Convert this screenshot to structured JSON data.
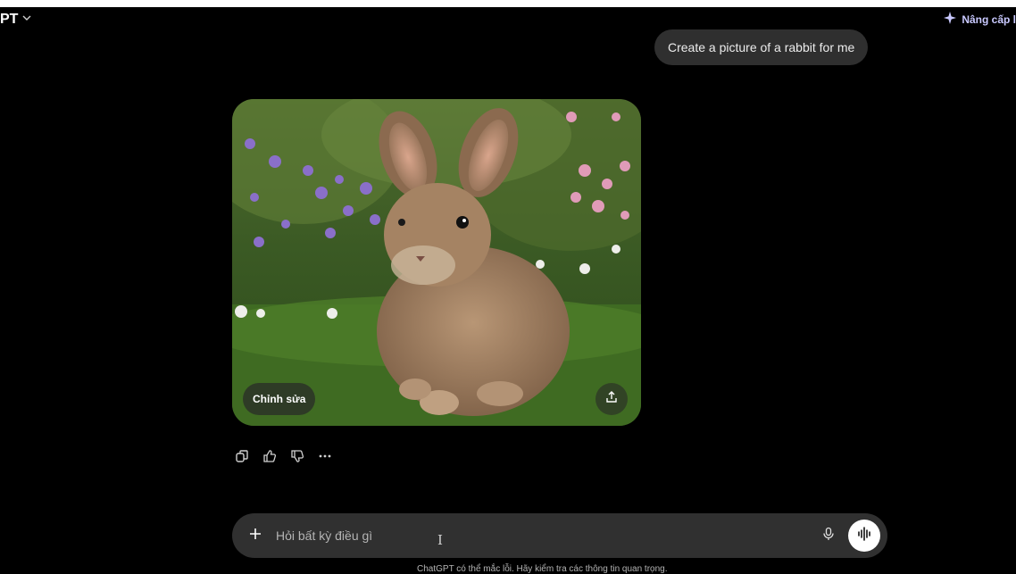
{
  "header": {
    "model_name": "PT",
    "upgrade_label": "Nâng cấp l"
  },
  "conversation": {
    "user_message": "Create a picture of a rabbit for me",
    "image": {
      "subject": "rabbit-photo",
      "edit_label": "Chỉnh sửa"
    },
    "actions": [
      "copy-icon",
      "thumbs-up-icon",
      "thumbs-down-icon",
      "more-icon"
    ]
  },
  "composer": {
    "placeholder": "Hỏi bất kỳ điều gì",
    "value": ""
  },
  "footer": {
    "disclaimer": "ChatGPT có thể mắc lỗi. Hãy kiểm tra các thông tin quan trọng."
  },
  "colors": {
    "background": "#000000",
    "bubble": "#2f2f2f",
    "composer": "#303030",
    "upgrade_accent": "#c9c9ff"
  }
}
